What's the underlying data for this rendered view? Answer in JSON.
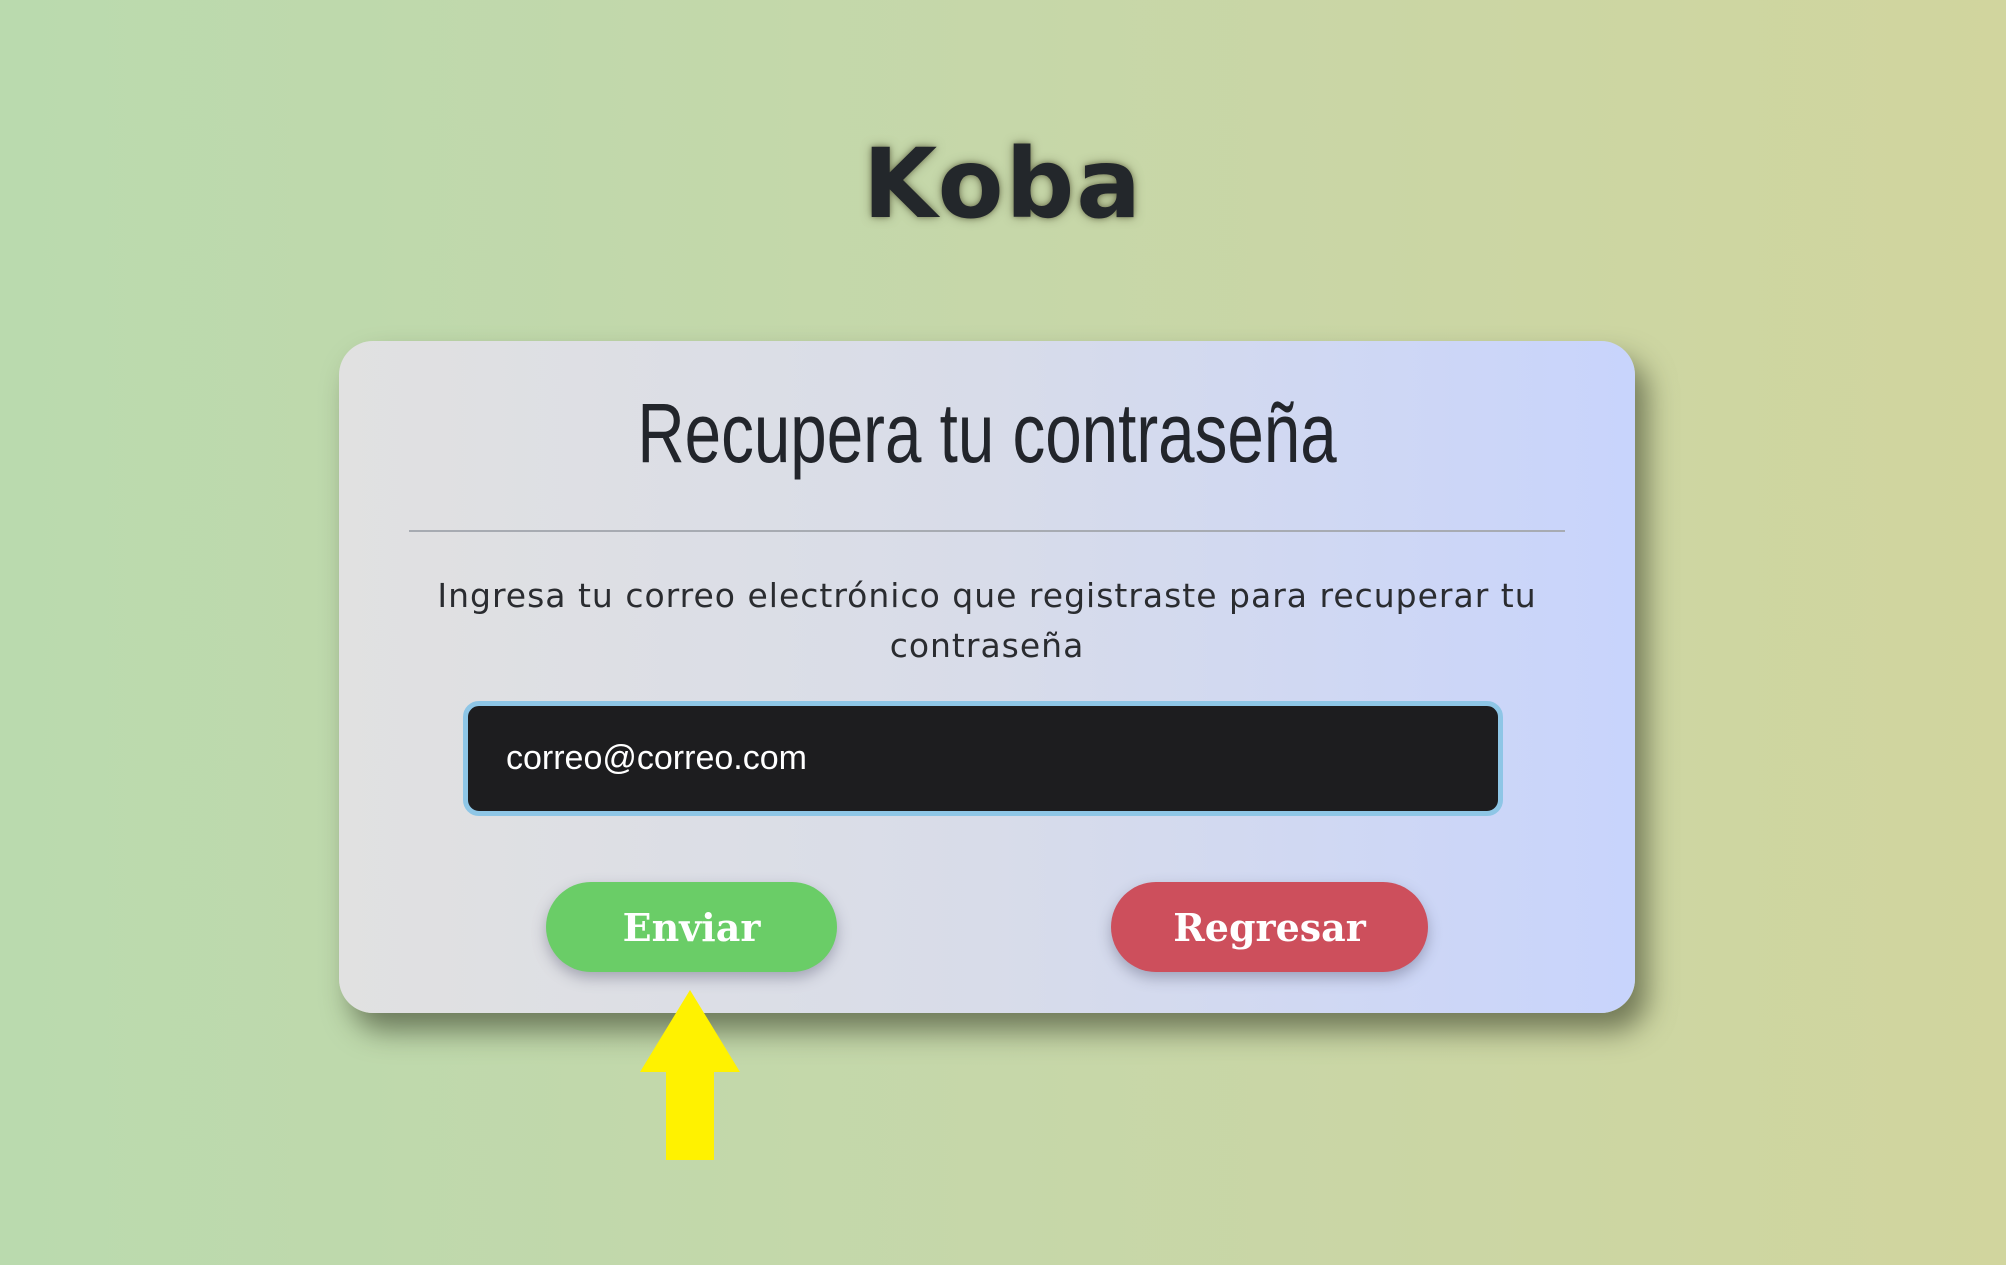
{
  "brand": {
    "name": "Koba"
  },
  "card": {
    "title": "Recupera tu contraseña",
    "instructions": "Ingresa tu correo electrónico que registraste para recuperar tu contraseña",
    "email": {
      "value": "correo@correo.com",
      "placeholder": ""
    },
    "send_label": "Enviar",
    "back_label": "Regresar"
  },
  "colors": {
    "send_button": "#6acd67",
    "back_button": "#cd4f5c",
    "input_background": "#1d1d1f",
    "input_border": "#8ec6e6",
    "annotation_arrow": "#fff200"
  },
  "icons": {
    "annotation": "up-arrow-icon"
  }
}
